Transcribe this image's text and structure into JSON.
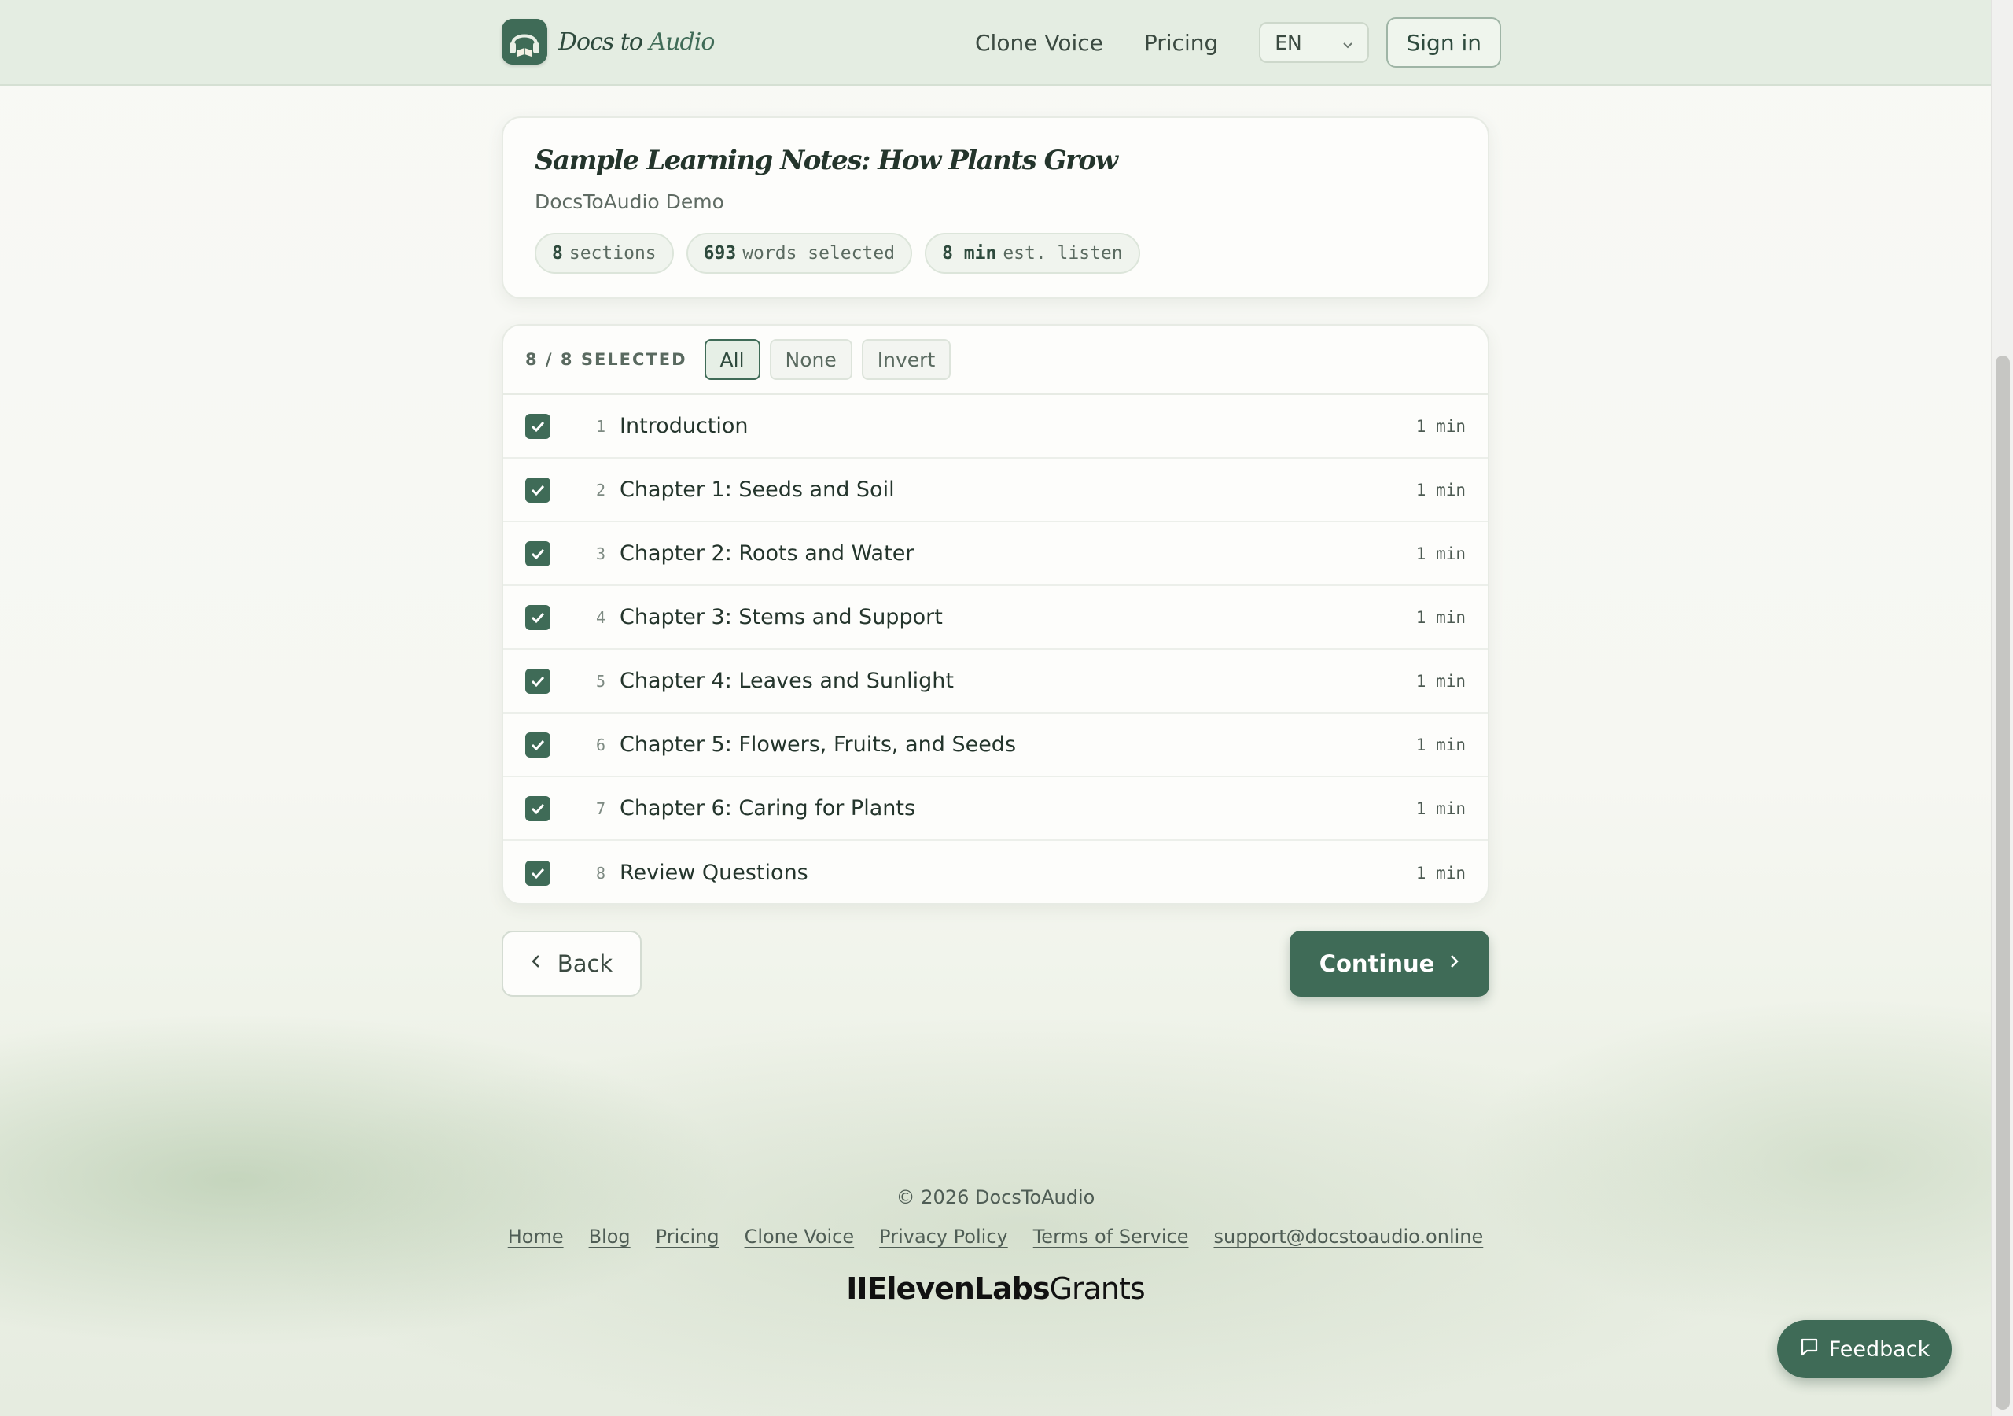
{
  "header": {
    "logo_word1": "Docs",
    "logo_word2": "to",
    "logo_word3": "Audio",
    "nav": [
      "Clone Voice",
      "Pricing"
    ],
    "language": "EN",
    "signin_label": "Sign in"
  },
  "document": {
    "title": "Sample Learning Notes: How Plants Grow",
    "author": "DocsToAudio Demo",
    "stats": [
      {
        "value": "8",
        "label": "sections"
      },
      {
        "value": "693",
        "label": "words selected"
      },
      {
        "value": "8 min",
        "label": "est. listen"
      }
    ]
  },
  "sections": {
    "selected_label": "8 / 8 SELECTED",
    "filters": [
      "All",
      "None",
      "Invert"
    ],
    "active_filter": "All",
    "items": [
      {
        "num": "1",
        "title": "Introduction",
        "duration": "1 min",
        "checked": true
      },
      {
        "num": "2",
        "title": "Chapter 1: Seeds and Soil",
        "duration": "1 min",
        "checked": true
      },
      {
        "num": "3",
        "title": "Chapter 2: Roots and Water",
        "duration": "1 min",
        "checked": true
      },
      {
        "num": "4",
        "title": "Chapter 3: Stems and Support",
        "duration": "1 min",
        "checked": true
      },
      {
        "num": "5",
        "title": "Chapter 4: Leaves and Sunlight",
        "duration": "1 min",
        "checked": true
      },
      {
        "num": "6",
        "title": "Chapter 5: Flowers, Fruits, and Seeds",
        "duration": "1 min",
        "checked": true
      },
      {
        "num": "7",
        "title": "Chapter 6: Caring for Plants",
        "duration": "1 min",
        "checked": true
      },
      {
        "num": "8",
        "title": "Review Questions",
        "duration": "1 min",
        "checked": true
      }
    ]
  },
  "actions": {
    "back_label": "Back",
    "continue_label": "Continue"
  },
  "footer": {
    "copyright": "© 2026 DocsToAudio",
    "links": [
      "Home",
      "Blog",
      "Pricing",
      "Clone Voice",
      "Privacy Policy",
      "Terms of Service",
      "support@docstoaudio.online"
    ],
    "grants_bold": "IIElevenLabs",
    "grants_light": "Grants"
  },
  "feedback_label": "Feedback",
  "colors": {
    "accent": "#3f6b57",
    "background": "#f7f8f4",
    "header_bg": "#e2ece0"
  },
  "icons": [
    "headphones-book-logo-icon",
    "chevron-down-icon",
    "checkbox-check-icon",
    "chevron-left-icon",
    "chevron-right-icon",
    "chat-bubble-icon"
  ]
}
